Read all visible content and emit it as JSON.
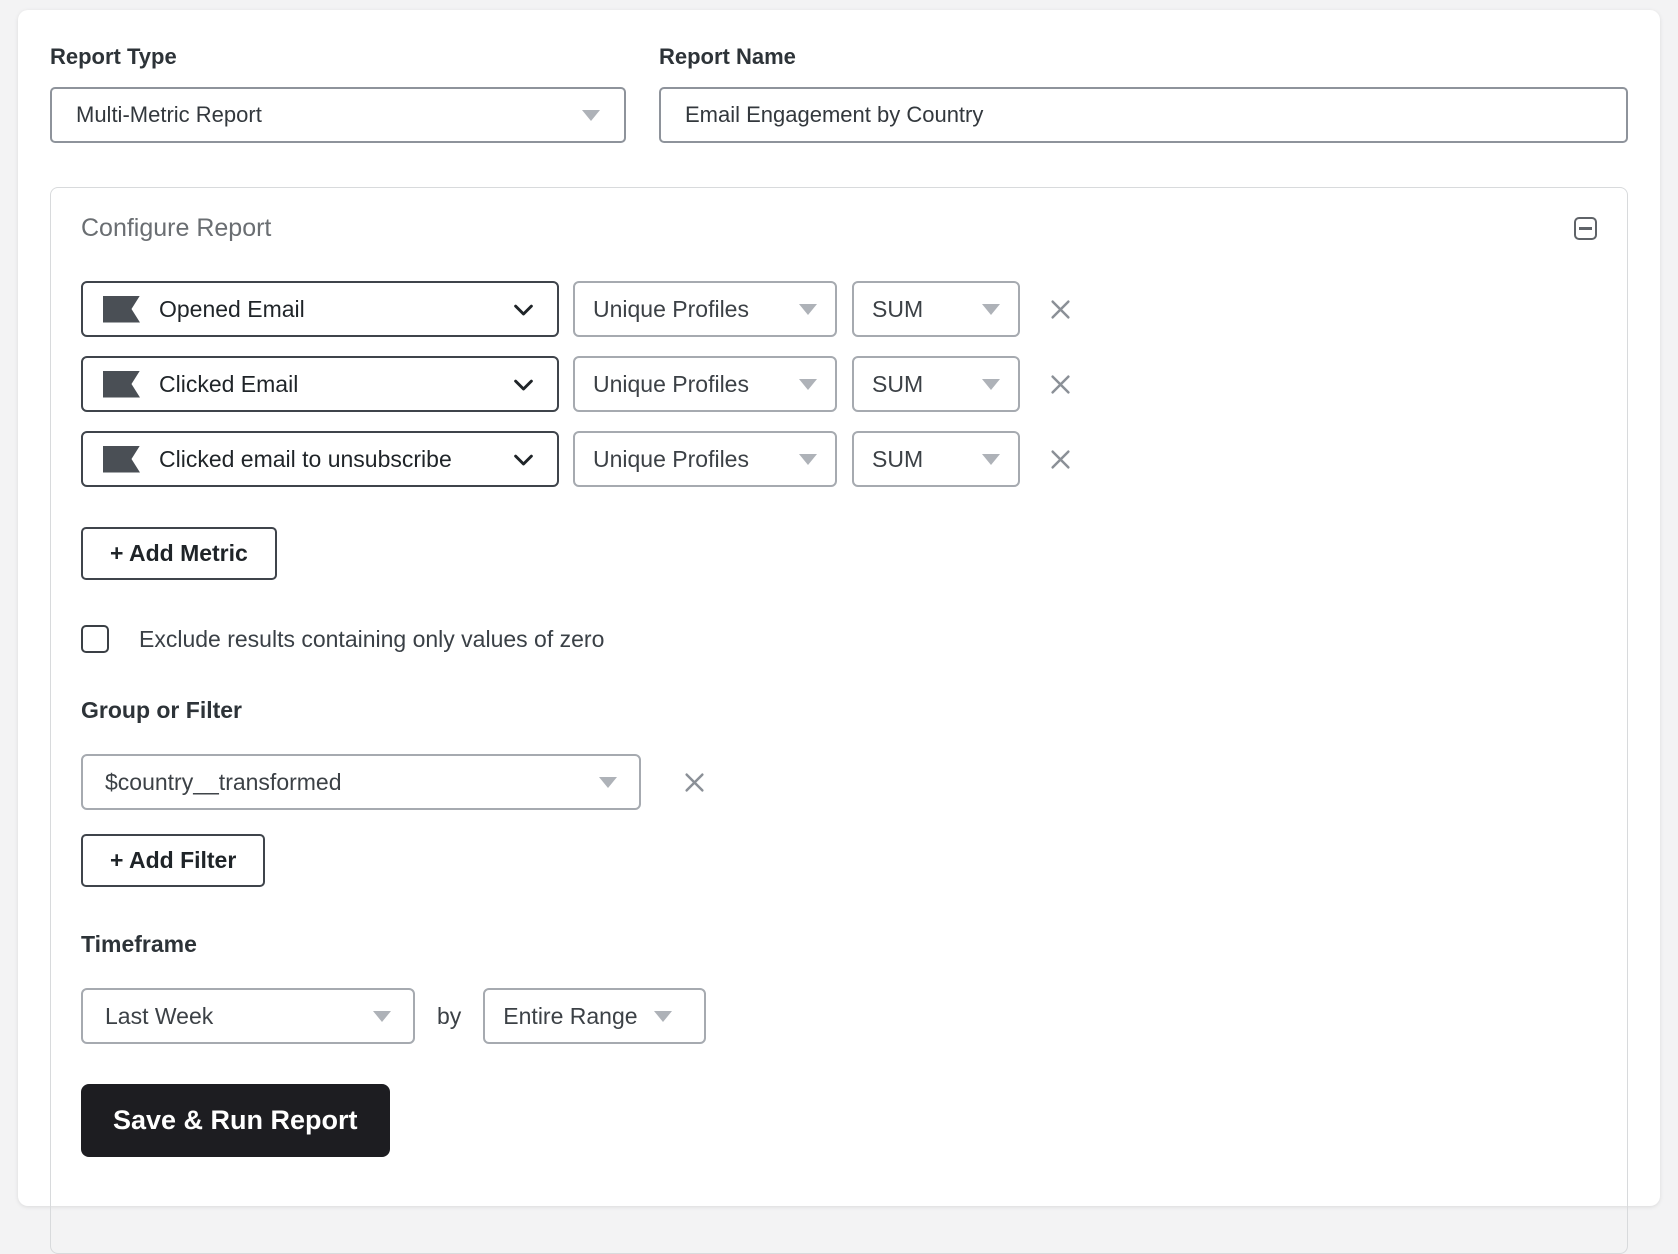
{
  "report_type": {
    "label": "Report Type",
    "value": "Multi-Metric Report"
  },
  "report_name": {
    "label": "Report Name",
    "value": "Email Engagement by Country"
  },
  "configure": {
    "title": "Configure Report",
    "metrics": [
      {
        "name": "Opened Email",
        "measurement": "Unique Profiles",
        "aggregation": "SUM"
      },
      {
        "name": "Clicked Email",
        "measurement": "Unique Profiles",
        "aggregation": "SUM"
      },
      {
        "name": "Clicked email to unsubscribe",
        "measurement": "Unique Profiles",
        "aggregation": "SUM"
      }
    ],
    "add_metric_label": "+ Add Metric",
    "exclude_zero": {
      "label": "Exclude results containing only values of zero",
      "checked": false
    },
    "group_or_filter": {
      "label": "Group or Filter",
      "value": "$country__transformed"
    },
    "add_filter_label": "+ Add Filter",
    "timeframe": {
      "label": "Timeframe",
      "range_value": "Last Week",
      "by_label": "by",
      "granularity_value": "Entire Range"
    },
    "save_button_label": "Save & Run Report"
  },
  "icons": {
    "collapse": "minus-square",
    "metric_flag": "flag",
    "dropdown_caret": "triangle-down",
    "metric_chevron": "chevron-down",
    "remove": "x"
  },
  "colors": {
    "page_bg": "#f3f3f4",
    "card_bg": "#ffffff",
    "dark_text": "#1f2428",
    "label_text": "#2d3338",
    "heading_gray": "#6a6e72",
    "border_light": "#a6aab0",
    "border_medium": "#8e939b",
    "border_dark": "#3f444b",
    "card_border": "#d8dadc",
    "caret_gray": "#aeb2b8",
    "flag_fill": "#4a4f55",
    "x_gray": "#8b9097",
    "save_button_bg": "#1d1d21",
    "save_button_text": "#ffffff"
  }
}
